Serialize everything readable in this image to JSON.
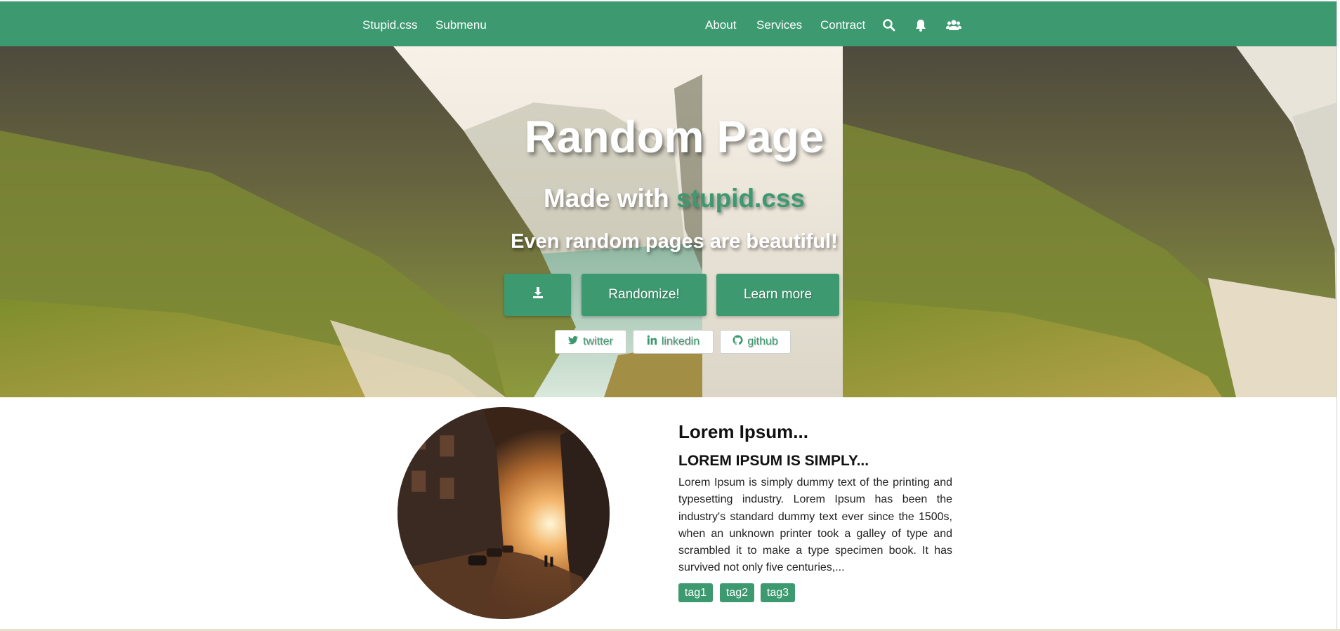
{
  "nav": {
    "brand": "Stupid.css",
    "submenu": "Submenu",
    "links": [
      "About",
      "Services",
      "Contract"
    ],
    "icons": [
      "search-icon",
      "bell-icon",
      "users-icon"
    ]
  },
  "hero": {
    "title": "Random Page",
    "subtitle_prefix": "Made with ",
    "subtitle_accent": "stupid.css",
    "tagline": "Even random pages are beautiful!",
    "buttons": {
      "download_icon": "download-icon",
      "randomize": "Randomize!",
      "learn_more": "Learn more"
    },
    "social": [
      {
        "label": "twitter",
        "icon": "twitter-icon"
      },
      {
        "label": "linkedin",
        "icon": "linkedin-icon"
      },
      {
        "label": "github",
        "icon": "github-icon"
      }
    ]
  },
  "content": {
    "title": "Lorem Ipsum...",
    "subtitle": "LOREM IPSUM IS SIMPLY...",
    "text": "Lorem Ipsum is simply dummy text of the printing and typesetting industry. Lorem Ipsum has been the industry's standard dummy text ever since the 1500s, when an unknown printer took a galley of type and scrambled it to make a type specimen book. It has survived not only five centuries,...",
    "tags": [
      "tag1",
      "tag2",
      "tag3"
    ]
  },
  "colors": {
    "accent": "#3d9970",
    "white": "#ffffff"
  }
}
